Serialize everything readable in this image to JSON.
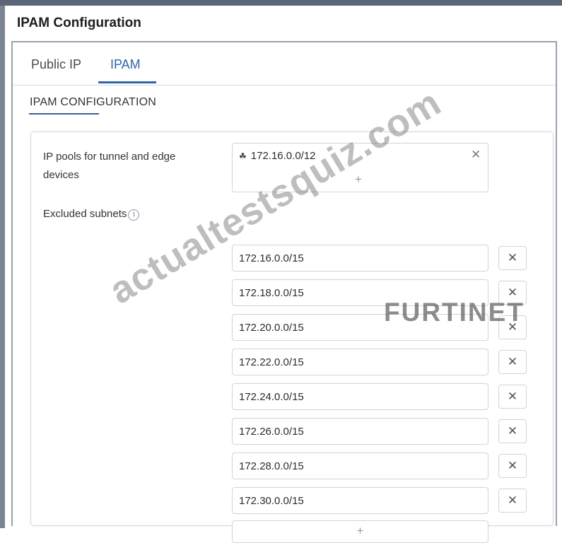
{
  "window": {
    "title": "IPAM Configuration"
  },
  "tabs": [
    {
      "label": "Public IP",
      "active": false
    },
    {
      "label": "IPAM",
      "active": true
    }
  ],
  "section": {
    "header": "IPAM CONFIGURATION"
  },
  "ip_pools": {
    "label": "IP pools for tunnel and edge devices",
    "items": [
      {
        "value": "172.16.0.0/12",
        "icon": "network-icon"
      }
    ],
    "add_label": "+",
    "remove_label": "✕"
  },
  "excluded_subnets": {
    "label": "Excluded subnets",
    "info_glyph": "i",
    "items": [
      {
        "value": "172.16.0.0/15"
      },
      {
        "value": "172.18.0.0/15"
      },
      {
        "value": "172.20.0.0/15"
      },
      {
        "value": "172.22.0.0/15"
      },
      {
        "value": "172.24.0.0/15"
      },
      {
        "value": "172.26.0.0/15"
      },
      {
        "value": "172.28.0.0/15"
      },
      {
        "value": "172.30.0.0/15"
      }
    ],
    "remove_label": "✕",
    "add_label": "+"
  },
  "overlays": {
    "watermark": "actualtestsquiz.com",
    "brand": "FURTINET"
  },
  "colors": {
    "accent": "#2f66a8",
    "frame_border": "#9aa1ad"
  }
}
